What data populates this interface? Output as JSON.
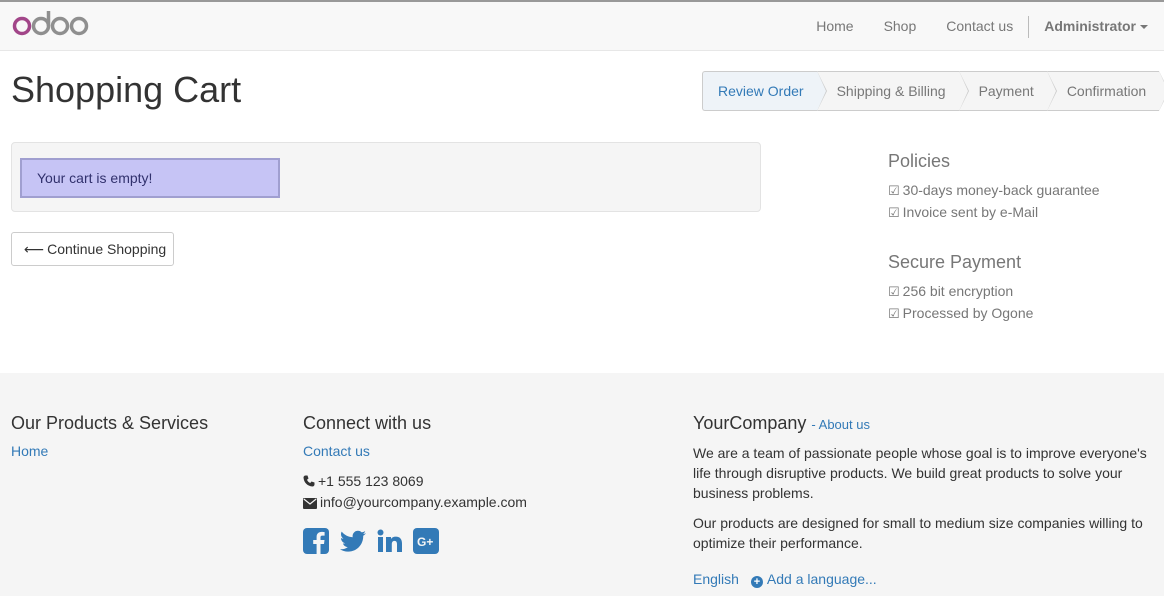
{
  "navbar": {
    "logo_text": "odoo",
    "links": [
      "Home",
      "Shop",
      "Contact us"
    ],
    "user": "Administrator"
  },
  "page": {
    "title": "Shopping Cart"
  },
  "wizard": {
    "steps": [
      "Review Order",
      "Shipping & Billing",
      "Payment",
      "Confirmation"
    ],
    "active": "Review Order"
  },
  "cart": {
    "empty_message": "Your cart is empty!",
    "continue_label": "Continue Shopping"
  },
  "sidebar": {
    "policies_title": "Policies",
    "policies": [
      "30-days money-back guarantee",
      "Invoice sent by e-Mail"
    ],
    "secure_title": "Secure Payment",
    "secure": [
      "256 bit encryption",
      "Processed by Ogone"
    ]
  },
  "footer": {
    "products_title": "Our Products & Services",
    "products_links": [
      "Home"
    ],
    "connect_title": "Connect with us",
    "contact_link": "Contact us",
    "phone": "+1 555 123 8069",
    "email": "info@yourcompany.example.com",
    "company_name": "YourCompany",
    "about_link": "- About us",
    "about_p1": "We are a team of passionate people whose goal is to improve everyone's life through disruptive products. We build great products to solve your business problems.",
    "about_p2": "Our products are designed for small to medium size companies willing to optimize their performance.",
    "language": "English",
    "add_language": "Add a language...",
    "social_icons": [
      "facebook-icon",
      "twitter-icon",
      "linkedin-icon",
      "google-plus-icon"
    ]
  },
  "colors": {
    "link": "#337ab7",
    "alert_bg": "#c6c4f5",
    "logo_purple": "#a24689",
    "logo_gray": "#8f8f8f"
  }
}
